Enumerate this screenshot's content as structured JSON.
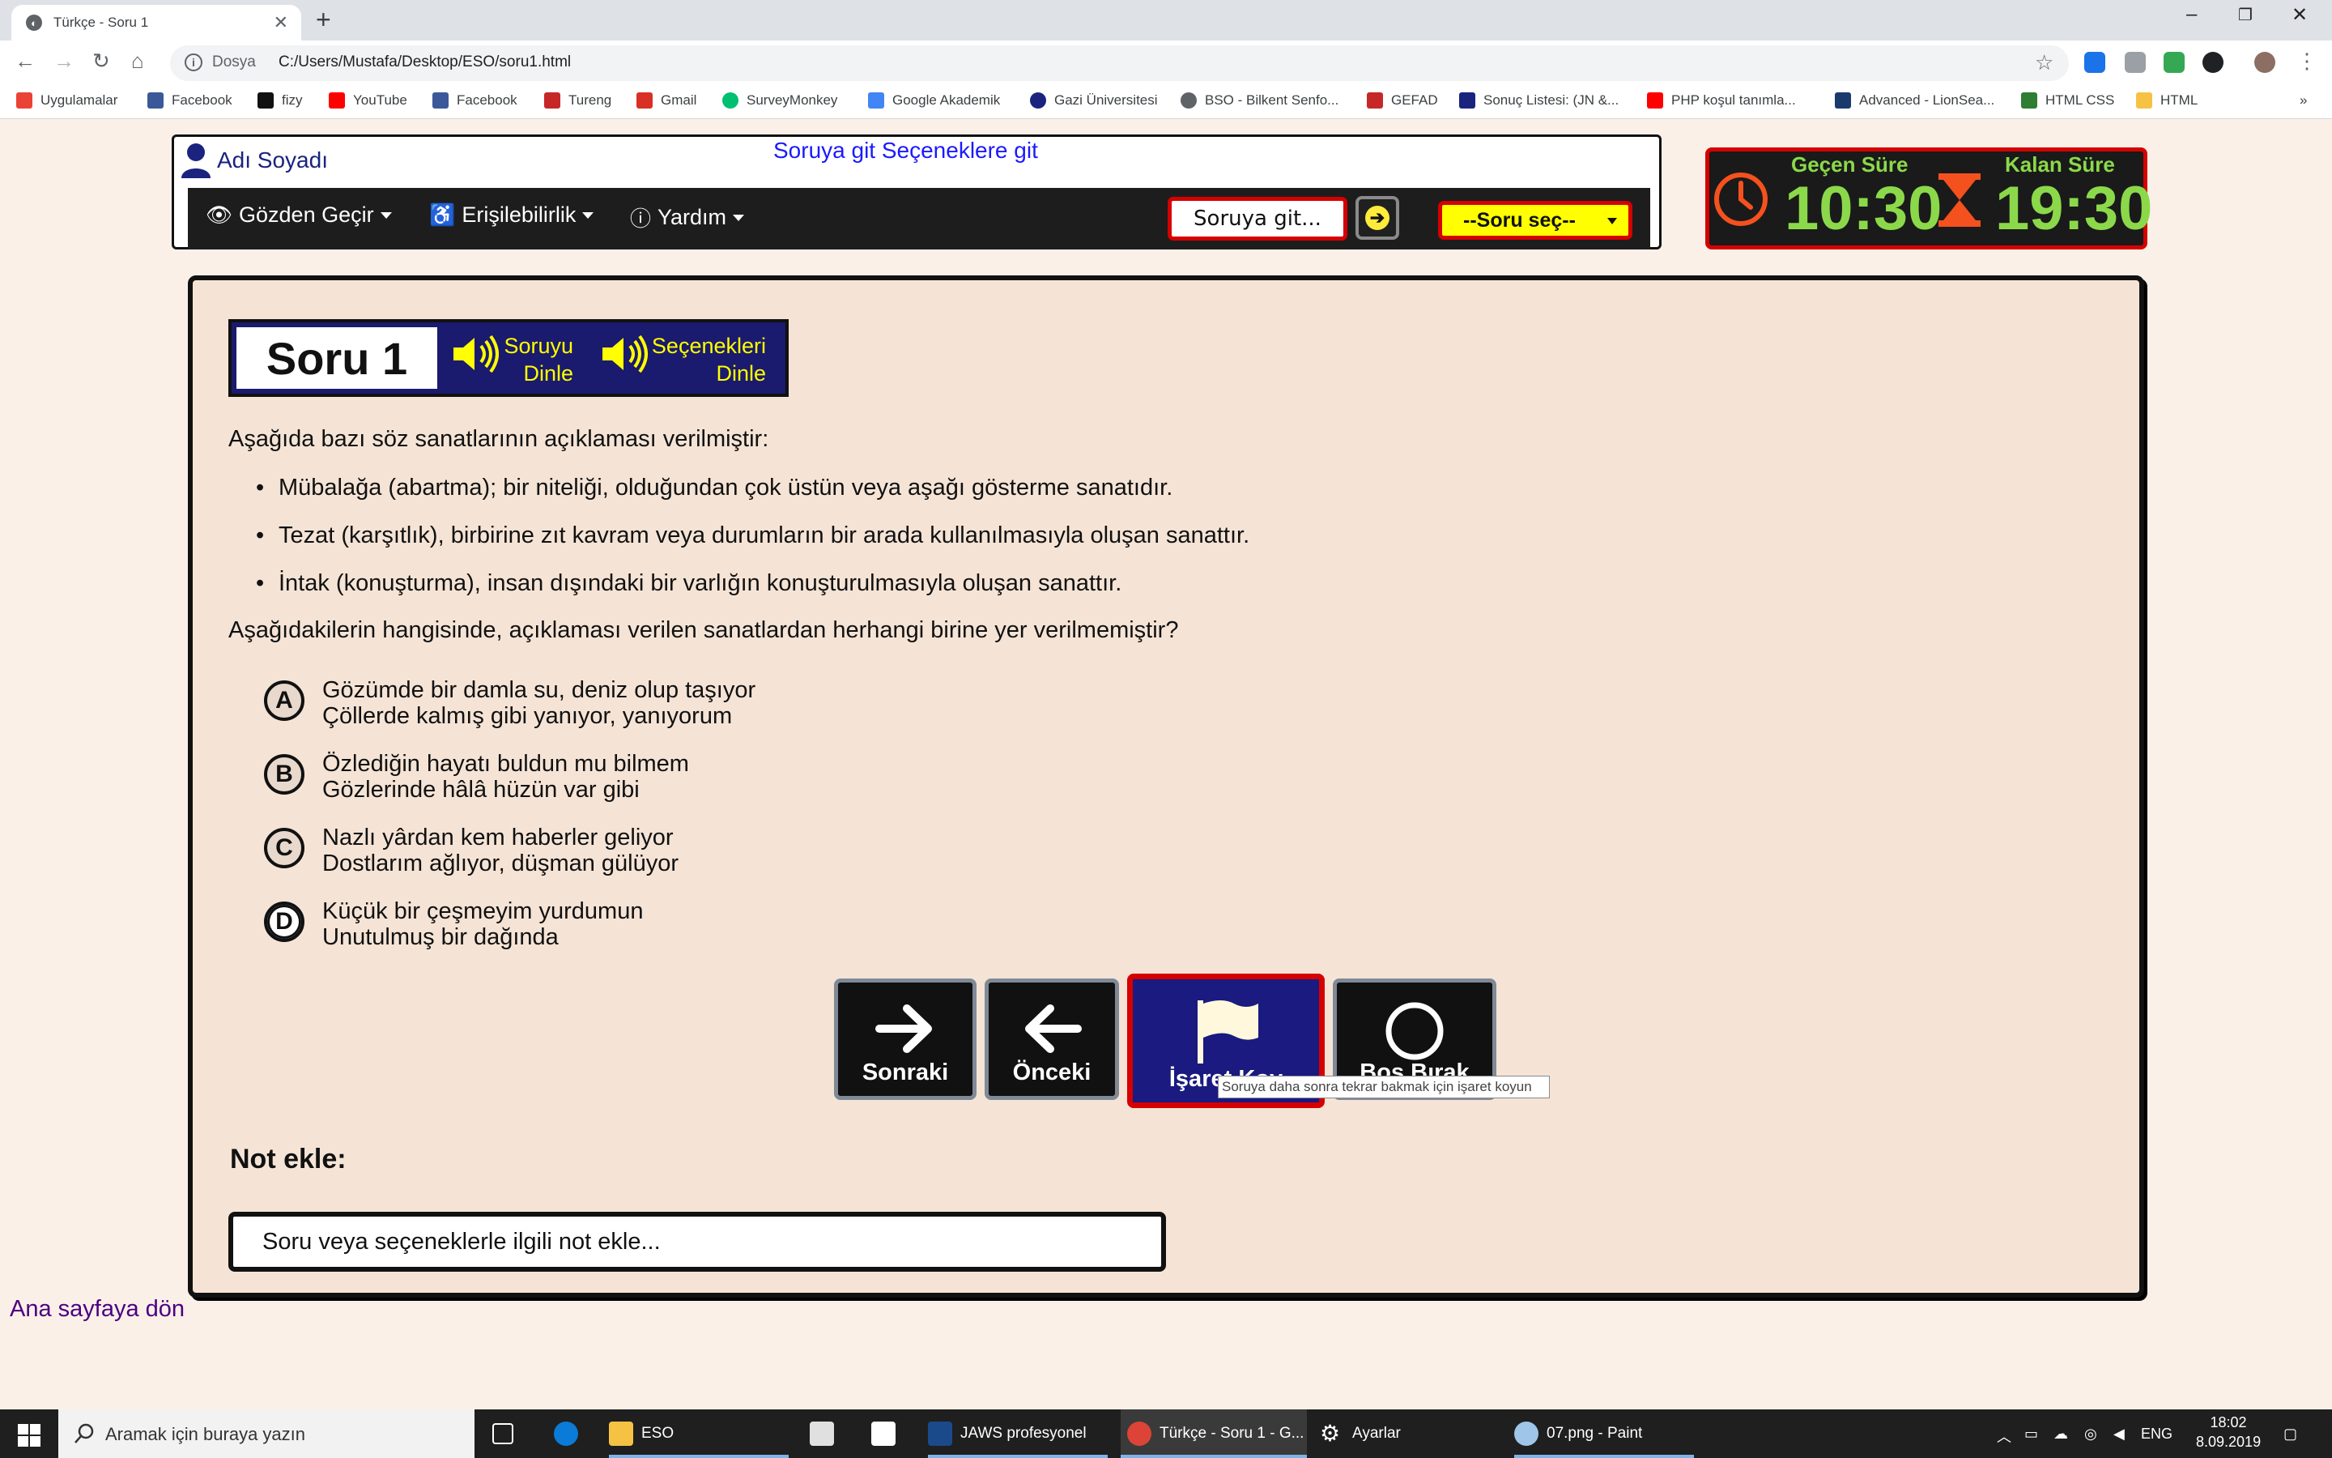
{
  "browser": {
    "tab_title": "Türkçe - Soru 1",
    "omnibox_label": "Dosya",
    "url": "C:/Users/Mustafa/Desktop/ESO/soru1.html",
    "bookmarks": [
      "Uygulamalar",
      "Facebook",
      "fizy",
      "YouTube",
      "Facebook",
      "Tureng",
      "Gmail",
      "SurveyMonkey",
      "Google Akademik",
      "Gazi Üniversitesi",
      "BSO - Bilkent Senfo...",
      "GEFAD",
      "Sonuç Listesi: (JN &...",
      "PHP koşul tanımla...",
      "Advanced - LionSea...",
      "HTML CSS",
      "HTML"
    ]
  },
  "header": {
    "user_name": "Adı Soyadı",
    "skip_links": "Soruya git Seçeneklere git",
    "menu": {
      "review": "Gözden Geçir",
      "accessibility": "Erişilebilirlik",
      "help": "Yardım"
    },
    "goto_placeholder": "Soruya git...",
    "question_select": "--Soru seç--"
  },
  "timer": {
    "elapsed_label": "Geçen Süre",
    "elapsed_value": "10:30",
    "remaining_label": "Kalan Süre",
    "remaining_value": "19:30",
    "color": "#8bd94a"
  },
  "question": {
    "title": "Soru 1",
    "listen_question": [
      "Soruyu",
      "Dinle"
    ],
    "listen_options": [
      "Seçenekleri",
      "Dinle"
    ],
    "intro": "Aşağıda bazı söz sanatlarının açıklaması verilmiştir:",
    "bullets": [
      "Mübalağa (abartma); bir niteliği, olduğundan çok üstün veya aşağı gösterme sanatıdır.",
      "Tezat (karşıtlık), birbirine zıt kavram veya durumların bir arada kullanılmasıyla oluşan sanattır.",
      "İntak (konuşturma), insan dışındaki bir varlığın konuşturulmasıyla oluşan sanattır."
    ],
    "prompt": "Aşağıdakilerin hangisinde, açıklaması verilen sanatlardan herhangi birine yer verilmemiştir?",
    "options": [
      {
        "letter": "A",
        "line1": "Gözümde bir damla su, deniz olup taşıyor",
        "line2": "Çöllerde kalmış gibi yanıyor, yanıyorum"
      },
      {
        "letter": "B",
        "line1": "Özlediğin hayatı buldun mu bilmem",
        "line2": "Gözlerinde hâlâ hüzün var gibi"
      },
      {
        "letter": "C",
        "line1": "Nazlı yârdan kem haberler geliyor",
        "line2": "Dostlarım ağlıyor, düşman gülüyor"
      },
      {
        "letter": "D",
        "line1": "Küçük bir çeşmeyim yurdumun",
        "line2": "Unutulmuş bir dağında"
      }
    ]
  },
  "nav_buttons": {
    "next": "Sonraki",
    "prev": "Önceki",
    "flag": "İşaret Koy",
    "skip": "Boş Bırak",
    "tooltip": "Soruya daha sonra tekrar bakmak için işaret koyun"
  },
  "notes": {
    "label": "Not ekle:",
    "placeholder": "Soru veya seçeneklerle ilgili not ekle..."
  },
  "back_link": "Ana sayfaya dön",
  "taskbar": {
    "search_placeholder": "Aramak için buraya yazın",
    "items": [
      "ESO",
      "JAWS profesyonel",
      "Türkçe - Soru 1 - G...",
      "Ayarlar",
      "07.png - Paint"
    ],
    "lang": "ENG",
    "time": "18:02",
    "date": "8.09.2019"
  }
}
